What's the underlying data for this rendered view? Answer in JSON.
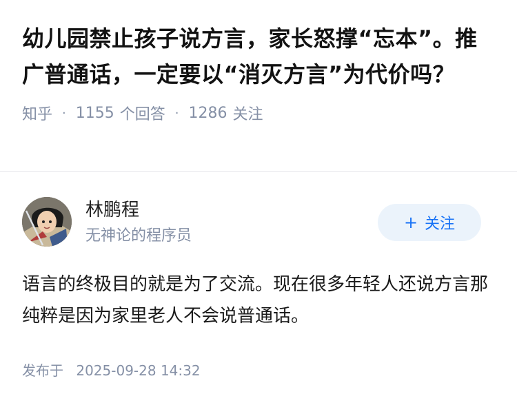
{
  "question": {
    "title": "幼儿园禁止孩子说方言，家长怒撑“忘本”。推广普通话，一定要以“消灭方言”为代价吗？",
    "source": "知乎",
    "answer_count": "1155",
    "answer_label": "个回答",
    "follow_count": "1286",
    "follow_label": "关注",
    "separator": "·"
  },
  "answer": {
    "author": {
      "name": "林鹏程",
      "bio": "无神论的程序员",
      "avatar_icon": "avatar-cartoon-warrior"
    },
    "follow_button": {
      "icon": "+",
      "label": "关注"
    },
    "content": "语言的终极目的就是为了交流。现在很多年轻人还说方言那纯粹是因为家里老人不会说普通话。",
    "publish_label": "发布于",
    "publish_time": "2025-09-28 14:32"
  },
  "colors": {
    "accent": "#1772f6",
    "button_bg": "#ebf3fb",
    "muted_text": "#8590a6",
    "title_text": "#121212"
  }
}
